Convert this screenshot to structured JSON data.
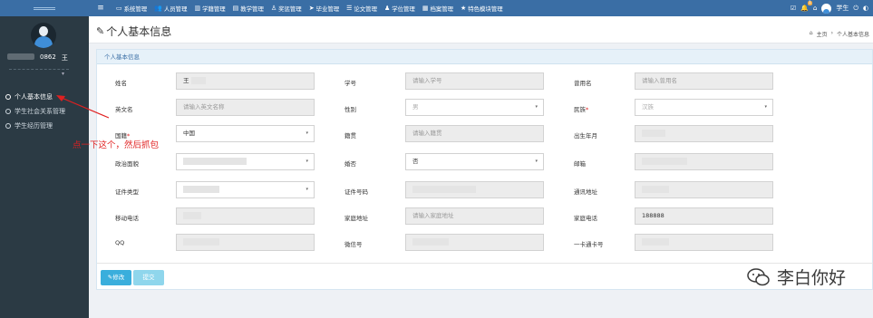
{
  "topnav": {
    "items": [
      {
        "icon": "desktop-icon",
        "glyph": "▭",
        "label": "系统管理"
      },
      {
        "icon": "users-icon",
        "glyph": "👥",
        "label": "人员管理"
      },
      {
        "icon": "book-icon",
        "glyph": "▥",
        "label": "学籍管理"
      },
      {
        "icon": "chart-icon",
        "glyph": "▤",
        "label": "教学管理"
      },
      {
        "icon": "person-icon",
        "glyph": "♙",
        "label": "奖惩管理"
      },
      {
        "icon": "plane-icon",
        "glyph": "➤",
        "label": "毕业管理"
      },
      {
        "icon": "list-icon",
        "glyph": "☰",
        "label": "论文管理"
      },
      {
        "icon": "mortarboard-icon",
        "glyph": "♟",
        "label": "学位管理"
      },
      {
        "icon": "calendar-icon",
        "glyph": "▦",
        "label": "档案管理"
      },
      {
        "icon": "star-icon",
        "glyph": "★",
        "label": "特色模块管理"
      }
    ],
    "right": {
      "user_label": "学生",
      "badge_count": "1"
    }
  },
  "sidebar": {
    "user_text": "0862",
    "user_name": "王",
    "items": [
      {
        "label": "个人基本信息"
      },
      {
        "label": "学生社会关系管理"
      },
      {
        "label": "学生经历管理"
      }
    ]
  },
  "page": {
    "title": "个人基本信息",
    "breadcrumb_home": "主页",
    "breadcrumb_current": "个人基本信息"
  },
  "panel": {
    "heading": "个人基本信息"
  },
  "form": {
    "name_label": "姓名",
    "name_value": "王",
    "student_no_label": "学号",
    "student_no_placeholder": "请输入学号",
    "former_name_label": "曾用名",
    "former_name_placeholder": "请输入曾用名",
    "english_name_label": "英文名",
    "english_name_placeholder": "请输入英文名称",
    "gender_label": "性别",
    "gender_value": "男",
    "ethnicity_label": "民族",
    "ethnicity_value": "汉族",
    "nationality_label": "国籍",
    "nationality_value": "中国",
    "native_place_label": "籍贯",
    "native_place_placeholder": "请输入籍贯",
    "birth_date_label": "出生年月",
    "politics_label": "政治面貌",
    "marital_label": "婚否",
    "marital_value": "否",
    "email_label": "邮箱",
    "id_type_label": "证件类型",
    "id_no_label": "证件号码",
    "address_label": "通讯地址",
    "mobile_label": "移动电话",
    "home_address_label": "家庭地址",
    "home_address_placeholder": "请输入家庭地址",
    "home_phone_label": "家庭电话",
    "home_phone_value": "188888",
    "qq_label": "QQ",
    "wechat_label": "微信号",
    "card_label": "一卡通卡号"
  },
  "buttons": {
    "edit_label": "修改",
    "submit_label": "提交"
  },
  "annotation": {
    "note": "点一下这个，然后抓包"
  },
  "watermark": {
    "text": "李白你好"
  }
}
